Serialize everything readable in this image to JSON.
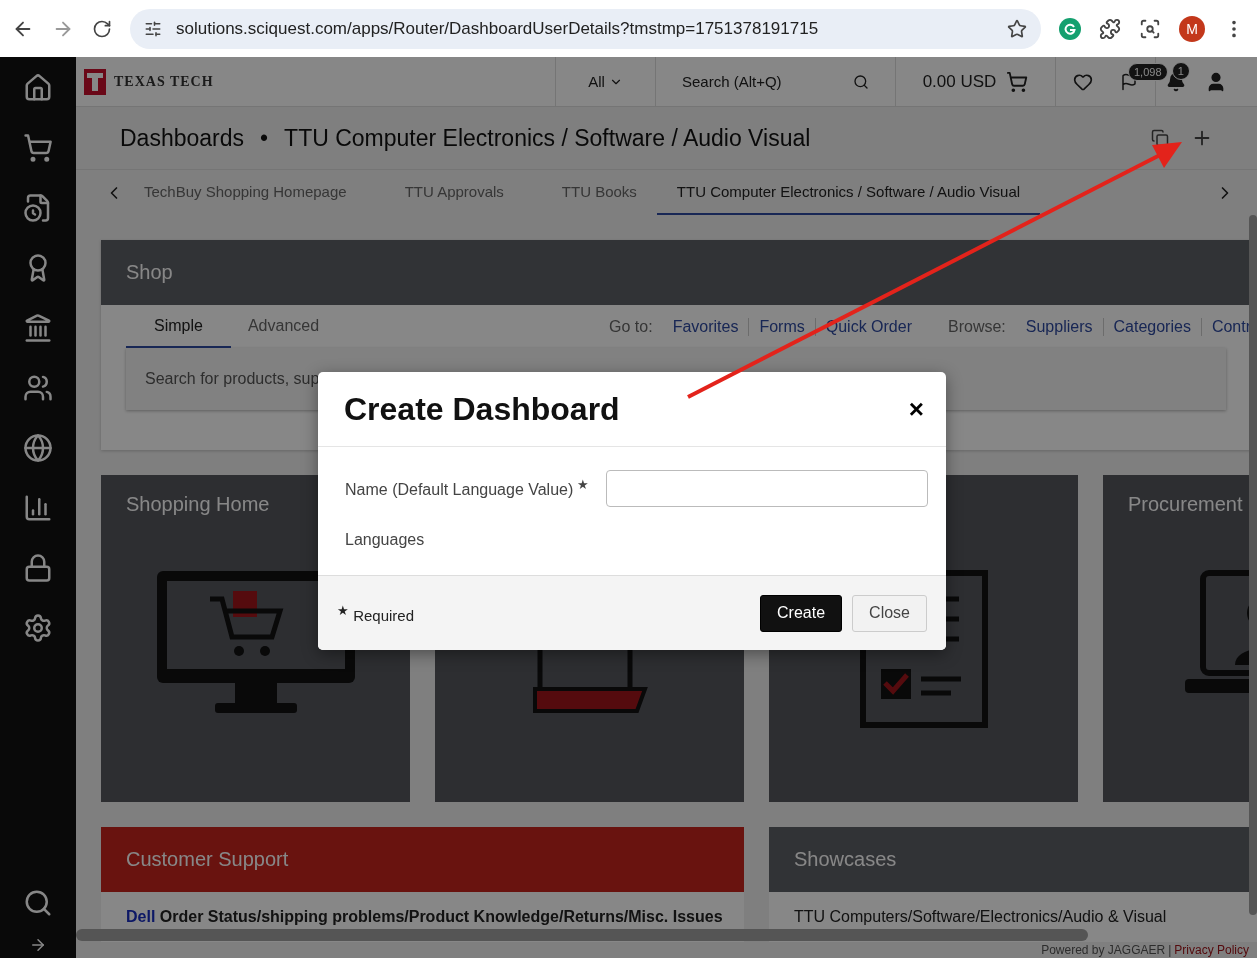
{
  "browser": {
    "url": "solutions.sciquest.com/apps/Router/DashboardUserDetails?tmstmp=1751378191715",
    "profile_initial": "M"
  },
  "header": {
    "logo_text": "TEXAS TECH",
    "search_scope": "All",
    "search_placeholder": "Search (Alt+Q)",
    "cart_total": "0.00 USD",
    "flag_badge": "1,098",
    "notification_badge": "1"
  },
  "page_title": {
    "section": "Dashboards",
    "separator": "•",
    "name": "TTU Computer Electronics / Software / Audio Visual"
  },
  "dashboard_tabs": [
    {
      "label": "TechBuy Shopping Homepage",
      "selected": false
    },
    {
      "label": "TTU Approvals",
      "selected": false
    },
    {
      "label": "TTU Books",
      "selected": false
    },
    {
      "label": "TTU Computer Electronics / Software / Audio Visual",
      "selected": true
    }
  ],
  "shop": {
    "title": "Shop",
    "mode_tabs": [
      {
        "label": "Simple",
        "selected": true
      },
      {
        "label": "Advanced",
        "selected": false
      }
    ],
    "goto_label": "Go to:",
    "goto_links": [
      "Favorites",
      "Forms",
      "Quick Order"
    ],
    "browse_label": "Browse:",
    "browse_links": [
      "Suppliers",
      "Categories",
      "Contr"
    ],
    "search_placeholder": "Search for products, sup"
  },
  "tiles": [
    {
      "title": "Shopping Home",
      "kind": "monitor"
    },
    {
      "kind": "receipt"
    },
    {
      "kind": "document"
    },
    {
      "title": "Procurement",
      "kind": "laptop"
    }
  ],
  "customer_support": {
    "title": "Customer Support",
    "vendor": "Dell",
    "text": "Order Status/shipping problems/Product Knowledge/Returns/Misc. Issues"
  },
  "showcases": {
    "title": "Showcases",
    "text": "TTU Computers/Software/Electronics/Audio & Visual"
  },
  "footer": {
    "powered": "Powered by JAGGAER",
    "separator": "|",
    "link": "Privacy Policy"
  },
  "modal": {
    "title": "Create Dashboard",
    "close": "×",
    "fields": [
      {
        "label": "Name (Default Language Value)",
        "required": true,
        "kind": "text"
      },
      {
        "label": "Languages",
        "required": false,
        "kind": "static"
      }
    ],
    "required_mark": "★",
    "required_note": "Required",
    "buttons": [
      {
        "label": "Create",
        "kind": "primary"
      },
      {
        "label": "Close",
        "kind": "secondary"
      }
    ]
  }
}
